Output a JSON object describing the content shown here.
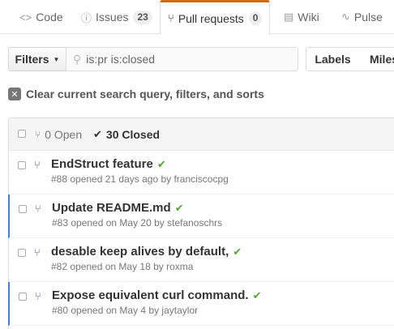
{
  "tabs": {
    "code": {
      "icon": "code-icon",
      "label": "Code"
    },
    "issues": {
      "icon": "issue-icon",
      "label": "Issues",
      "count": "23"
    },
    "pulls": {
      "icon": "pull-request-icon",
      "label": "Pull requests",
      "count": "0"
    },
    "wiki": {
      "icon": "book-icon",
      "label": "Wiki"
    },
    "pulse": {
      "icon": "pulse-icon",
      "label": "Pulse"
    }
  },
  "filters": {
    "filters_label": "Filters",
    "search_value": "is:pr is:closed",
    "labels_label": "Labels",
    "milestones_label": "Miles"
  },
  "clear": {
    "label": "Clear current search query, filters, and sorts"
  },
  "list": {
    "open_label": "0 Open",
    "closed_label": "30 Closed",
    "items": [
      {
        "title": "EndStruct feature",
        "meta": "#88 opened 21 days ago by franciscocpg",
        "status": "success"
      },
      {
        "title": "Update README.md",
        "meta": "#83 opened on May 20 by stefanoschrs",
        "status": "success"
      },
      {
        "title": "desable keep alives by default,",
        "meta": "#82 opened on May 18 by roxma",
        "status": "success"
      },
      {
        "title": "Expose equivalent curl command.",
        "meta": "#80 opened on May 4 by jaytaylor",
        "status": "success"
      }
    ]
  },
  "colors": {
    "accent_tab": "#d26911",
    "success": "#55a532",
    "pr_icon": "#6e5494",
    "row_highlight": "#4183c4"
  }
}
